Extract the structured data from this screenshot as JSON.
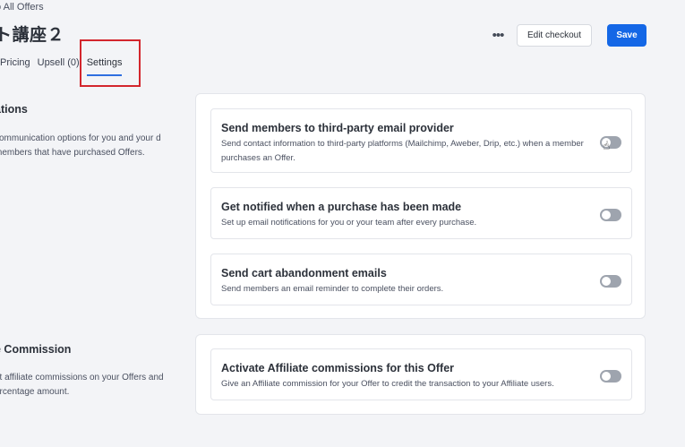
{
  "header": {
    "back_link": "to All Offers",
    "title": "ト講座２",
    "more_icon": "more-horizontal-icon",
    "edit_checkout_label": "Edit checkout",
    "save_label": "Save"
  },
  "tabs": [
    {
      "label": "Pricing",
      "active": false
    },
    {
      "label": "Upsell (0)",
      "active": false
    },
    {
      "label": "Settings",
      "active": true
    }
  ],
  "sections": {
    "notifications": {
      "title": "ations",
      "description": "communication options for you and your d members that have purchased Offers.",
      "options": [
        {
          "title": "Send members to third-party email provider",
          "description": "Send contact information to third-party platforms (Mailchimp, Aweber, Drip, etc.) when a member purchases an Offer.",
          "enabled": false
        },
        {
          "title": "Get notified when a purchase has been made",
          "description": "Set up email notifications for you or your team after every purchase.",
          "enabled": false
        },
        {
          "title": "Send cart abandonment emails",
          "description": "Send members an email reminder to complete their orders.",
          "enabled": false
        }
      ]
    },
    "affiliate": {
      "title": "e Commission",
      "description": "et affiliate commissions on your Offers and ercentage amount.",
      "options": [
        {
          "title": "Activate Affiliate commissions for this Offer",
          "description": "Give an Affiliate commission for your Offer to credit the transaction to your Affiliate users.",
          "enabled": false
        }
      ]
    }
  },
  "colors": {
    "accent": "#1467e6",
    "highlight": "#d3262d",
    "toggle_off": "#9ea4ae"
  }
}
